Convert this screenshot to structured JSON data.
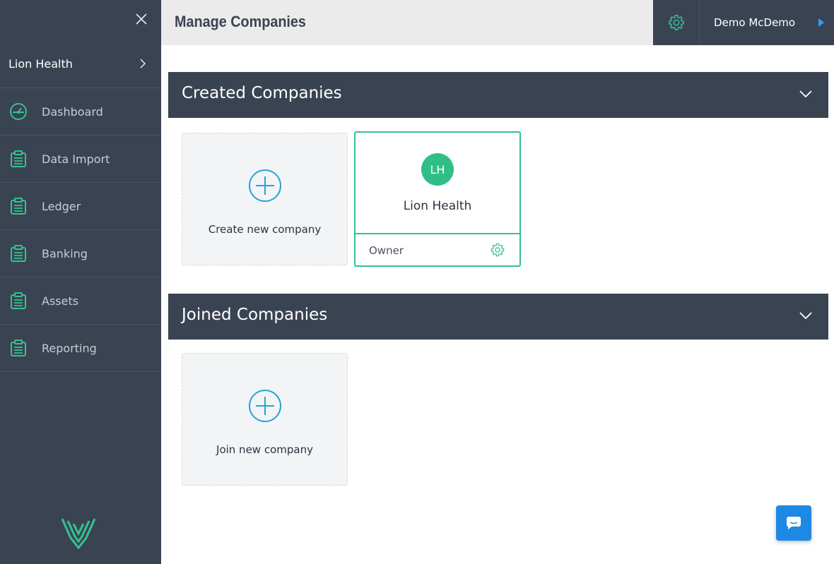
{
  "sidebar": {
    "company_name": "Lion Health",
    "items": [
      {
        "label": "Dashboard",
        "icon": "dashboard-gauge-icon"
      },
      {
        "label": "Data Import",
        "icon": "clipboard-icon"
      },
      {
        "label": "Ledger",
        "icon": "clipboard-icon"
      },
      {
        "label": "Banking",
        "icon": "clipboard-icon"
      },
      {
        "label": "Assets",
        "icon": "clipboard-icon"
      },
      {
        "label": "Reporting",
        "icon": "clipboard-icon"
      }
    ]
  },
  "header": {
    "title": "Manage Companies",
    "user_name": "Demo McDemo"
  },
  "sections": {
    "created": {
      "title": "Created Companies",
      "add_label": "Create new company",
      "companies": [
        {
          "initials": "LH",
          "name": "Lion Health",
          "role": "Owner"
        }
      ]
    },
    "joined": {
      "title": "Joined Companies",
      "add_label": "Join new company"
    }
  },
  "colors": {
    "sidebar_bg": "#3a4352",
    "accent_green": "#35c28e",
    "accent_blue": "#2f9ff5",
    "chat_blue": "#1e88e5"
  }
}
